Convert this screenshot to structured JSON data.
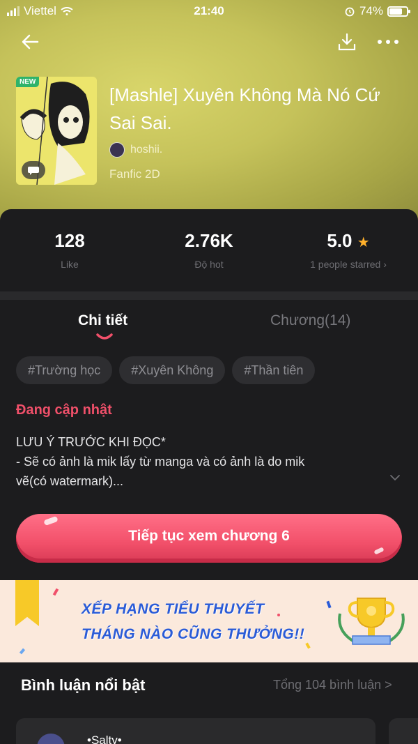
{
  "status_bar": {
    "carrier": "Viettel",
    "time": "21:40",
    "battery": "74%",
    "battery_level": 0.74
  },
  "story": {
    "title": "[Mashle] Xuyên Không Mà Nó Cứ Sai Sai.",
    "author": "hoshii.",
    "genre": "Fanfic 2D",
    "badge": "NEW"
  },
  "stats": {
    "likes_value": "128",
    "likes_label": "Like",
    "hot_value": "2.76K",
    "hot_label": "Độ hot",
    "rating_value": "5.0",
    "rating_label": "1 people starred"
  },
  "tabs": {
    "details": "Chi tiết",
    "chapters": "Chương(14)"
  },
  "tags": [
    "#Trường học",
    "#Xuyên Không",
    "#Thần tiên"
  ],
  "update_status": "Đang cập nhật",
  "description": {
    "line1": "LƯU Ý TRƯỚC KHI ĐỌC*",
    "line2": "- Sẽ có ảnh là mik lấy từ manga và có ảnh là do mik",
    "line3": "vẽ(có watermark)..."
  },
  "continue_button": "Tiếp tục xem chương 6",
  "banner": {
    "line1": "XẾP HẠNG TIỂU THUYẾT",
    "line2": "THÁNG NÀO CŨNG THƯỞNG!!"
  },
  "comments": {
    "title": "Bình luận nổi bật",
    "total": "Tổng 104 bình luận >",
    "first_user": "•Salty•"
  },
  "colors": {
    "accent": "#f2506a",
    "panel": "#1c1c1e",
    "hero": "#c5c25a",
    "star": "#ffb12b"
  }
}
